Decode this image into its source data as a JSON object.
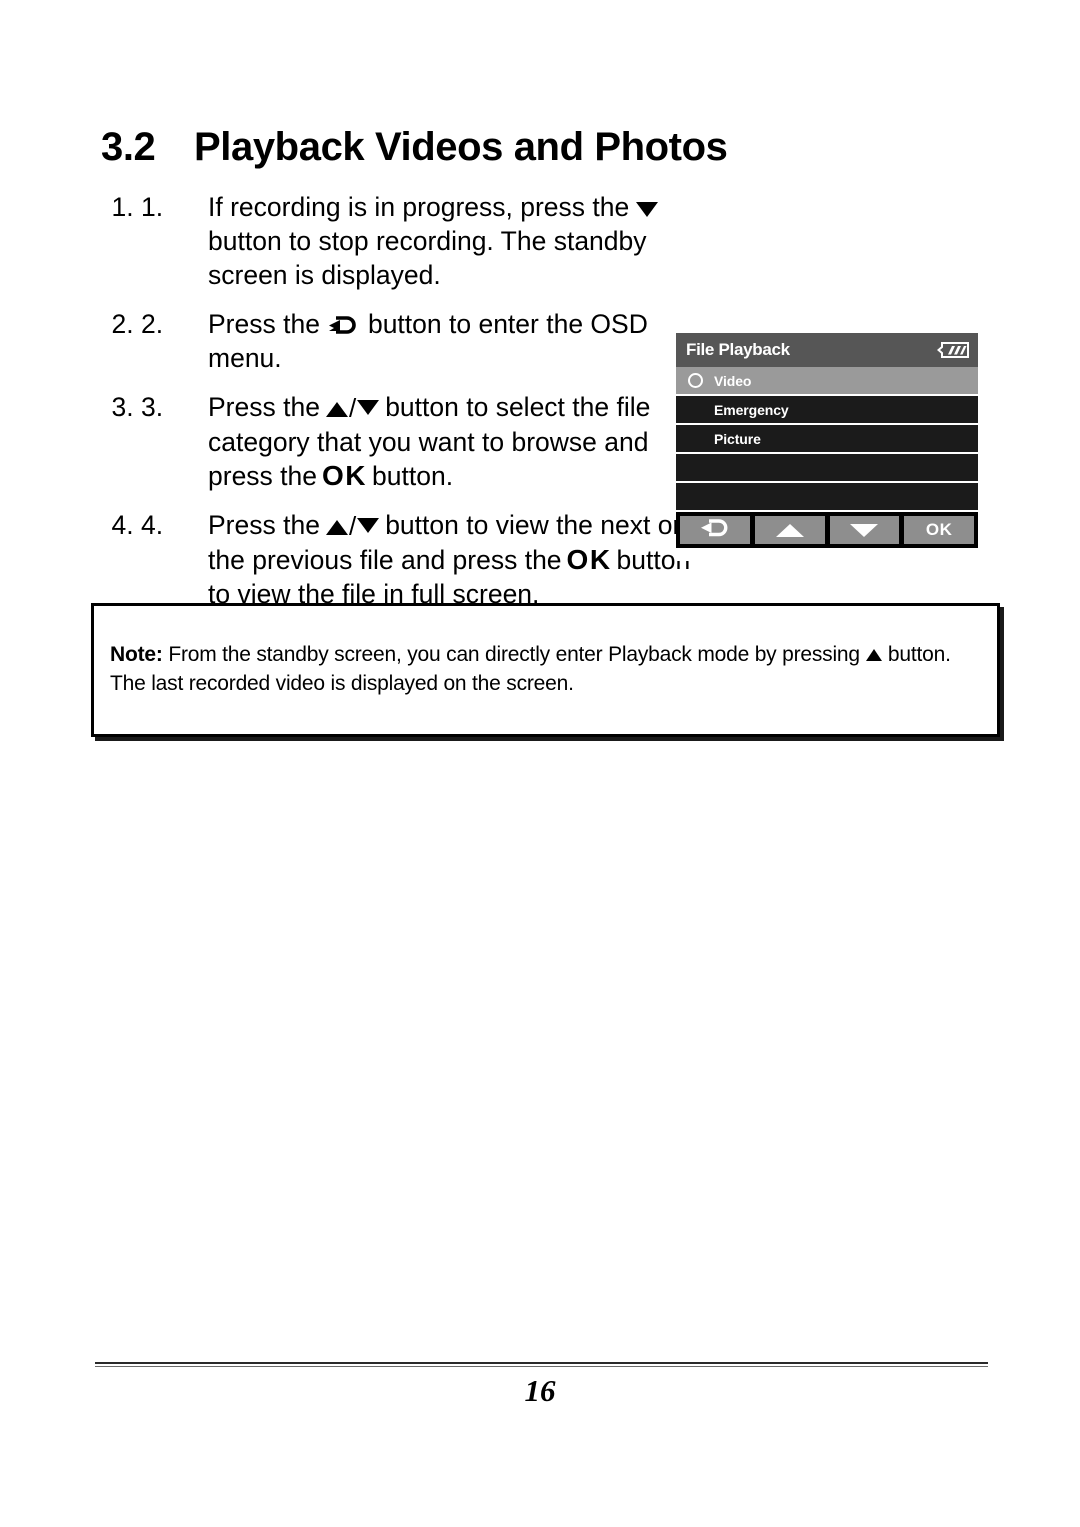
{
  "document": {
    "heading": {
      "number": "3.2",
      "title": "Playback Videos and Photos"
    },
    "steps": [
      {
        "marker": "1.",
        "text_before": "If recording is in progress, press the",
        "glyph": "triangle-down-icon",
        "text_after": "button to stop recording. The standby screen is displayed."
      },
      {
        "marker": "2.",
        "text_before": "Press the",
        "glyph": "return-arrow-icon",
        "text_after": "button to enter the OSD menu."
      },
      {
        "marker": "3.",
        "text_before": "Press the",
        "glyph": "triangle-up-down-icon",
        "text_mid": "button to select the file category that you want to browse and press the",
        "glyph2": "ok-label",
        "ok_label": "OK",
        "text_after": "button."
      },
      {
        "marker": "4.",
        "text_before": "Press the",
        "glyph": "triangle-up-down-icon",
        "text_mid": "button to view the next or the previous file and press the",
        "glyph2": "ok-label",
        "ok_label": "OK",
        "text_after": "button to view the file in full screen."
      }
    ],
    "note": {
      "label": "Note:",
      "text_before": "From the standby screen, you can directly enter Playback mode by pressing",
      "glyph": "triangle-up-icon",
      "text_after": "button. The last recorded video is displayed on the screen."
    },
    "footer": {
      "page_number": "16"
    }
  },
  "osd": {
    "title": "File Playback",
    "battery_icon": "battery-full-icon",
    "rows": [
      {
        "label": "Video",
        "selected": true,
        "radio": true
      },
      {
        "label": "Emergency",
        "selected": false,
        "radio": false
      },
      {
        "label": "Picture",
        "selected": false,
        "radio": false
      },
      {
        "label": "",
        "selected": false,
        "radio": false
      },
      {
        "label": "",
        "selected": false,
        "radio": false
      }
    ],
    "buttons": [
      {
        "name": "return",
        "icon": "return-arrow-icon",
        "label": ""
      },
      {
        "name": "up",
        "icon": "triangle-up-icon",
        "label": ""
      },
      {
        "name": "down",
        "icon": "triangle-down-icon",
        "label": ""
      },
      {
        "name": "ok",
        "icon": "",
        "label": "OK"
      }
    ],
    "colors": {
      "title_bar": "#565656",
      "row_selected": "#9a9a9a",
      "row_normal": "#1b1b1b",
      "button_face": "#8e8e8e",
      "button_bar": "#000000"
    }
  }
}
